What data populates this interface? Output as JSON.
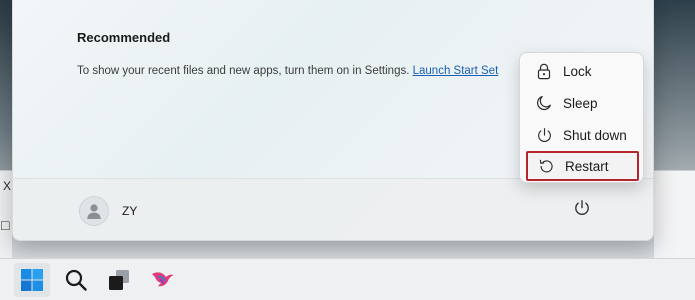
{
  "start_menu": {
    "recommended_title": "Recommended",
    "recommended_desc": "To show your recent files and new apps, turn them on in Settings.",
    "recommended_link": "Launch Start Set",
    "user": {
      "name": "ZY",
      "icon": "user-avatar-icon"
    },
    "power_icon": "power-icon"
  },
  "power_menu": {
    "items": [
      {
        "label": "Lock",
        "icon": "lock-icon"
      },
      {
        "label": "Sleep",
        "icon": "moon-icon"
      },
      {
        "label": "Shut down",
        "icon": "power-icon"
      },
      {
        "label": "Restart",
        "icon": "restart-icon",
        "selected": true
      }
    ],
    "highlight_color": "#b3262e"
  },
  "taskbar": {
    "items": [
      {
        "name": "start",
        "icon": "windows-logo-icon",
        "active": true
      },
      {
        "name": "search",
        "icon": "search-icon"
      },
      {
        "name": "task-view",
        "icon": "task-view-icon"
      },
      {
        "name": "app",
        "icon": "bird-app-icon"
      }
    ]
  },
  "fragments": {
    "left_x": "X",
    "left_box": "□"
  }
}
